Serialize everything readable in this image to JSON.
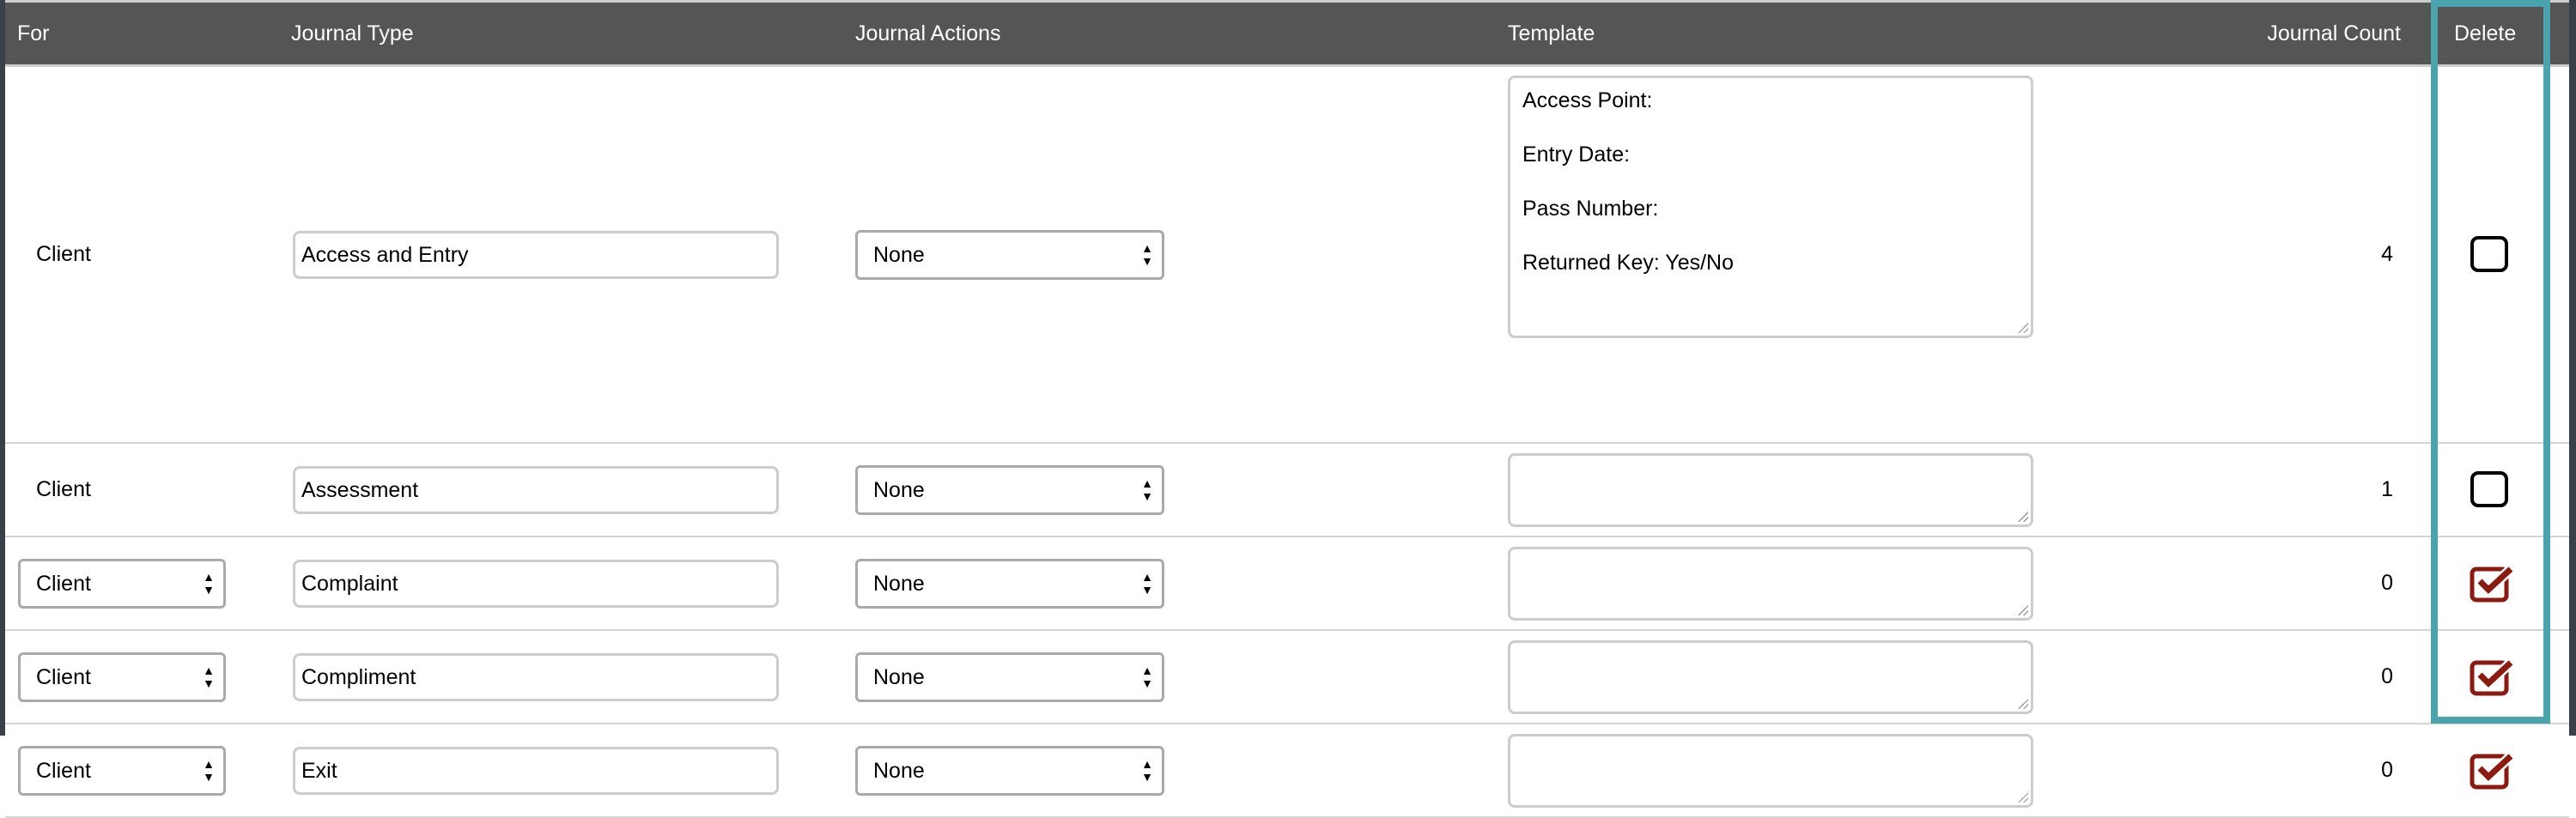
{
  "header": {
    "for": "For",
    "journal_type": "Journal Type",
    "journal_actions": "Journal Actions",
    "template": "Template",
    "journal_count": "Journal Count",
    "delete": "Delete"
  },
  "rows": [
    {
      "for": "Client",
      "for_editable": false,
      "journal_type": "Access and Entry",
      "action": "None",
      "template": [
        "Access Point:",
        "Entry Date:",
        "Pass Number:",
        "Returned Key:  Yes/No"
      ],
      "count": "4",
      "delete": false
    },
    {
      "for": "Client",
      "for_editable": false,
      "journal_type": "Assessment",
      "action": "None",
      "template": [],
      "count": "1",
      "delete": false
    },
    {
      "for": "Client",
      "for_editable": true,
      "journal_type": "Complaint",
      "action": "None",
      "template": [],
      "count": "0",
      "delete": true
    },
    {
      "for": "Client",
      "for_editable": true,
      "journal_type": "Compliment",
      "action": "None",
      "template": [],
      "count": "0",
      "delete": true
    },
    {
      "for": "Client",
      "for_editable": true,
      "journal_type": "Exit",
      "action": "None",
      "template": [],
      "count": "0",
      "delete": true
    }
  ],
  "colors": {
    "header_bg": "#555555",
    "highlight": "#4aa4ae",
    "checked": "#8b1a10"
  }
}
